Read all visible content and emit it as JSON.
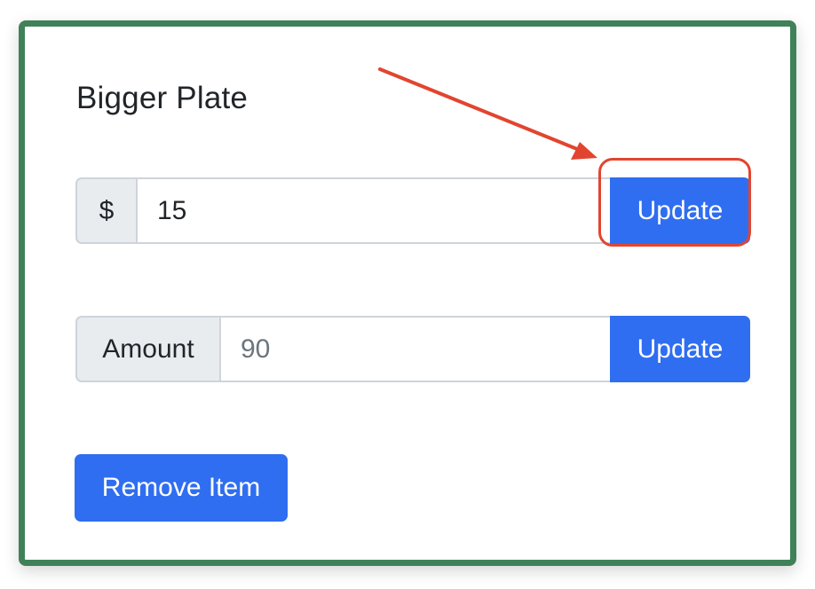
{
  "item": {
    "title": "Bigger Plate"
  },
  "price_group": {
    "prefix": "$",
    "value": "15",
    "button_label": "Update"
  },
  "amount_group": {
    "prefix": "Amount",
    "placeholder": "90",
    "value": "",
    "button_label": "Update"
  },
  "remove_button": {
    "label": "Remove Item"
  },
  "colors": {
    "card_border": "#41815a",
    "primary_button": "#2f6ef0",
    "annotation": "#e2452f",
    "addon_background": "#e9ecef"
  },
  "annotation": {
    "type": "arrow-and-box",
    "target": "price-update-button"
  }
}
